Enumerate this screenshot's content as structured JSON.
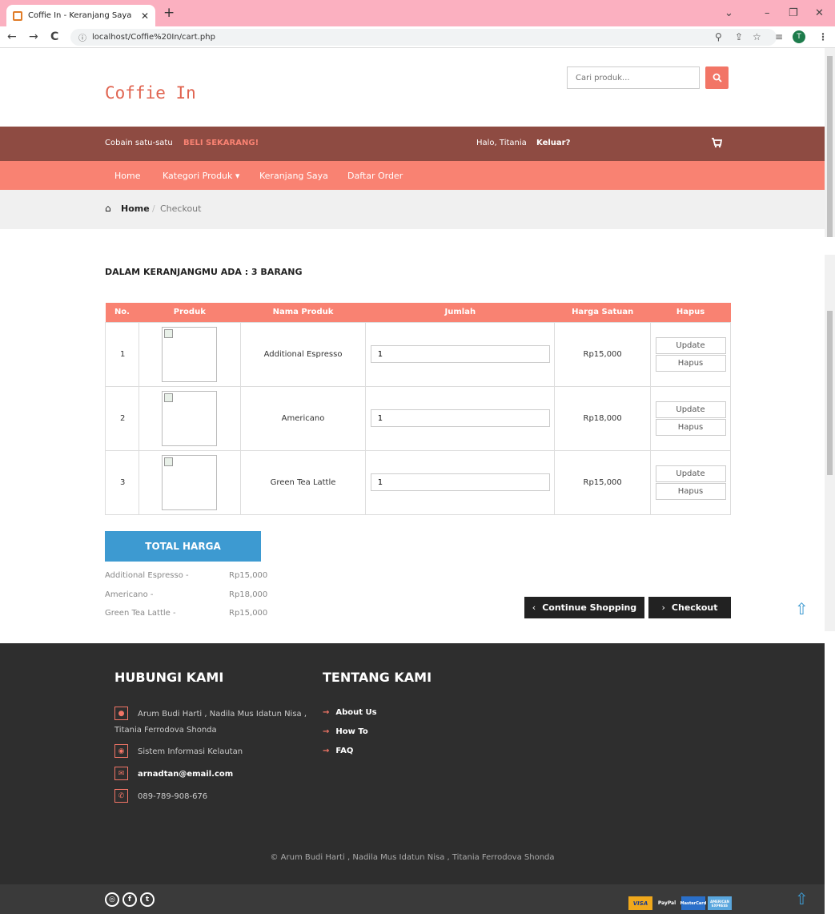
{
  "browser": {
    "tab_title": "Coffie In - Keranjang Saya",
    "url": "localhost/Coffie%20In/cart.php",
    "avatar_letter": "T"
  },
  "header": {
    "logo": "Coffie In",
    "search_placeholder": "Cari produk..."
  },
  "topbar": {
    "promo_text": "Cobain satu-satu",
    "promo_link": "BELI SEKARANG!",
    "greeting": "Halo, Titania",
    "logout": "Keluar?"
  },
  "menu": {
    "items": [
      "Home",
      "Kategori Produk",
      "Keranjang Saya",
      "Daftar Order"
    ]
  },
  "breadcrumb": {
    "home": "Home",
    "separator": "/",
    "current": "Checkout"
  },
  "cart": {
    "heading": "DALAM KERANJANGMU ADA : 3 BARANG",
    "columns": [
      "No.",
      "Produk",
      "Nama Produk",
      "Jumlah",
      "Harga Satuan",
      "Hapus"
    ],
    "rows": [
      {
        "no": "1",
        "name": "Additional Espresso",
        "qty": "1",
        "price": "Rp15,000"
      },
      {
        "no": "2",
        "name": "Americano",
        "qty": "1",
        "price": "Rp18,000"
      },
      {
        "no": "3",
        "name": "Green Tea Lattle",
        "qty": "1",
        "price": "Rp15,000"
      }
    ],
    "update_label": "Update",
    "delete_label": "Hapus"
  },
  "summary": {
    "title": "TOTAL HARGA",
    "lines": [
      {
        "label": "Additional Espresso -",
        "value": "Rp15,000"
      },
      {
        "label": "Americano -",
        "value": "Rp18,000"
      },
      {
        "label": "Green Tea Lattle -",
        "value": "Rp15,000"
      }
    ],
    "continue_label": "Continue Shopping",
    "checkout_label": "Checkout"
  },
  "footer": {
    "contact_title": "HUBUNGI KAMI",
    "about_title": "TENTANG KAMI",
    "contact_names_1": "Arum Budi Harti , Nadila Mus Idatun Nisa ,",
    "contact_names_2": "Titania Ferrodova Shonda",
    "address": "Sistem Informasi Kelautan",
    "email": "arnadtan@email.com",
    "phone": "089-789-908-676",
    "links": [
      "About Us",
      "How To",
      "FAQ"
    ],
    "copyright": "© Arum Budi Harti , Nadila Mus Idatun Nisa , Titania Ferrodova Shonda"
  },
  "payment_cards": [
    "VISA",
    "PayPal",
    "MasterCard",
    "AMERICAN EXPRESS"
  ],
  "colors": {
    "accent": "#f98272",
    "topbar": "#8e4b42",
    "total_box": "#3d9ad1",
    "footer": "#2e2e2e"
  }
}
